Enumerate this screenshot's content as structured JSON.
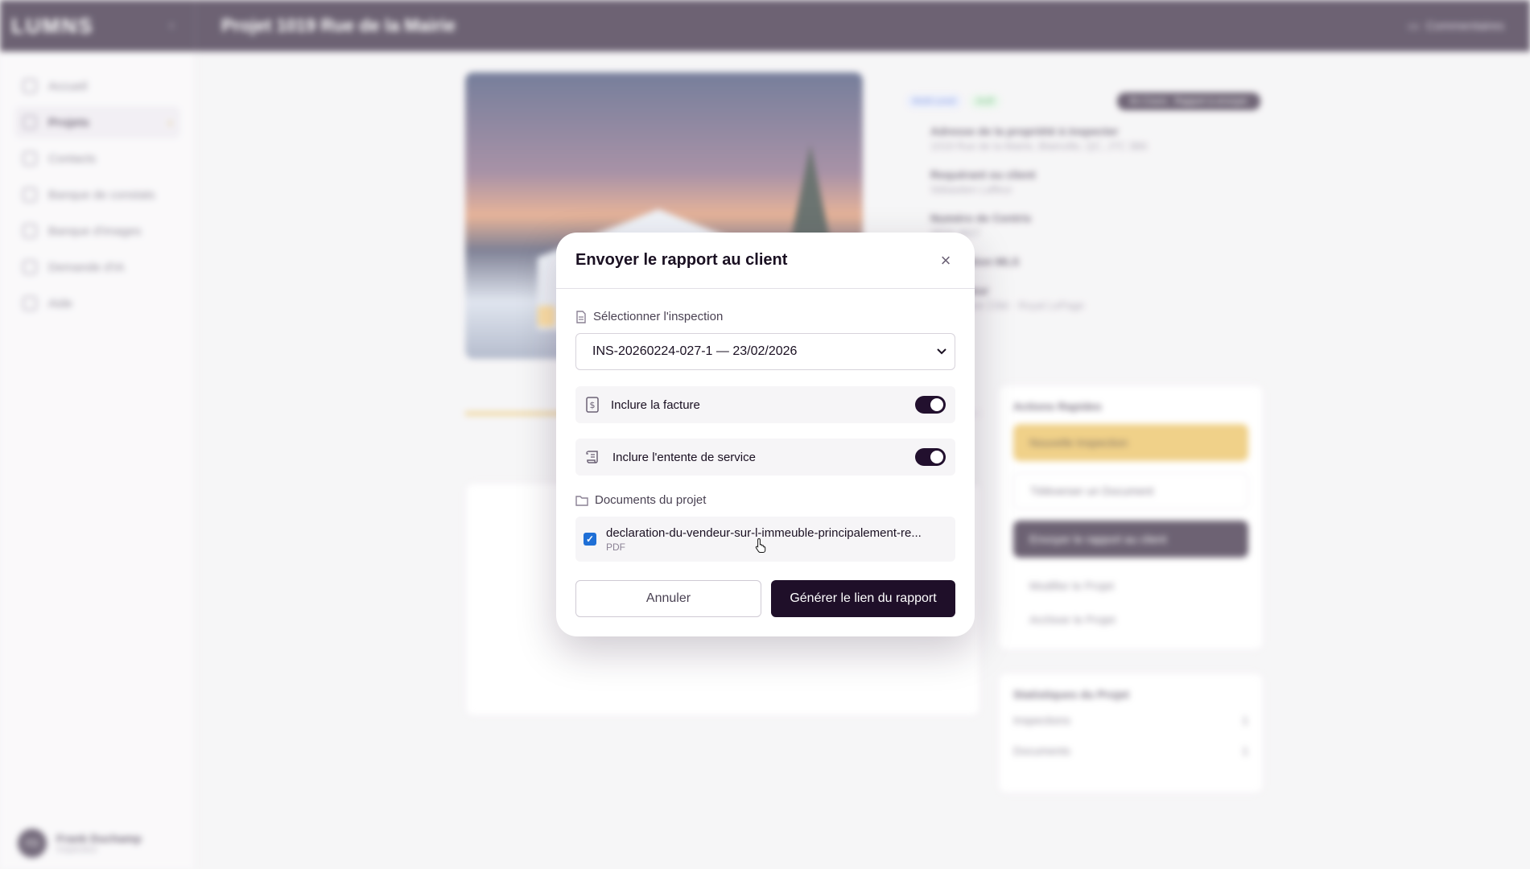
{
  "app": {
    "logo": "LUMNS",
    "project_title": "Projet 1019 Rue de la Mairie",
    "comments_label": "Commentaires"
  },
  "sidebar": {
    "items": [
      {
        "label": "Accueil"
      },
      {
        "label": "Projets"
      },
      {
        "label": "Contacts"
      },
      {
        "label": "Banque de constats"
      },
      {
        "label": "Banque d'images"
      },
      {
        "label": "Demande d'IA"
      },
      {
        "label": "Aide"
      }
    ],
    "user": {
      "initials": "FD",
      "name": "Frank Duchamp",
      "role": "Inspecteur"
    }
  },
  "project_info": {
    "badges": [
      "Multi-Level",
      "Actif"
    ],
    "status_pill": "En Cours · Rapport à envoyer",
    "rows": [
      {
        "label": "Adresse de la propriété à inspecter",
        "value": "1019 Rue de la Mairie, Blainville, QC, J7C 3B6"
      },
      {
        "label": "Requérant ou client",
        "value": "Sébastien Laffeur"
      },
      {
        "label": "Numéro de Centris",
        "value": "2834-4827"
      },
      {
        "label": "Description MLS",
        "value": ""
      },
      {
        "label": "Inscripteur",
        "value": "1 Stéphane Côté · Royal LePage"
      }
    ]
  },
  "quick_actions": {
    "title": "Actions Rapides",
    "new_inspection": "Nouvelle Inspection",
    "upload_document": "Téléverser un Document",
    "send_report": "Envoyer le rapport au client",
    "edit_project": "Modifier le Projet",
    "archive_project": "Archiver le Projet"
  },
  "stats": {
    "title": "Statistiques du Projet",
    "rows": [
      {
        "label": "Inspections",
        "value": "1"
      },
      {
        "label": "Documents",
        "value": "1"
      }
    ]
  },
  "modal": {
    "title": "Envoyer le rapport au client",
    "select_label": "Sélectionner l'inspection",
    "selected_inspection": "INS-20260224-027-1 — 23/02/2026",
    "include_invoice_label": "Inclure la facture",
    "include_invoice": true,
    "include_agreement_label": "Inclure l'entente de service",
    "include_agreement": true,
    "documents_label": "Documents du projet",
    "documents": [
      {
        "name": "declaration-du-vendeur-sur-l-immeuble-principalement-re...",
        "type": "PDF",
        "checked": true
      }
    ],
    "cancel_label": "Annuler",
    "generate_label": "Générer le lien du rapport"
  }
}
